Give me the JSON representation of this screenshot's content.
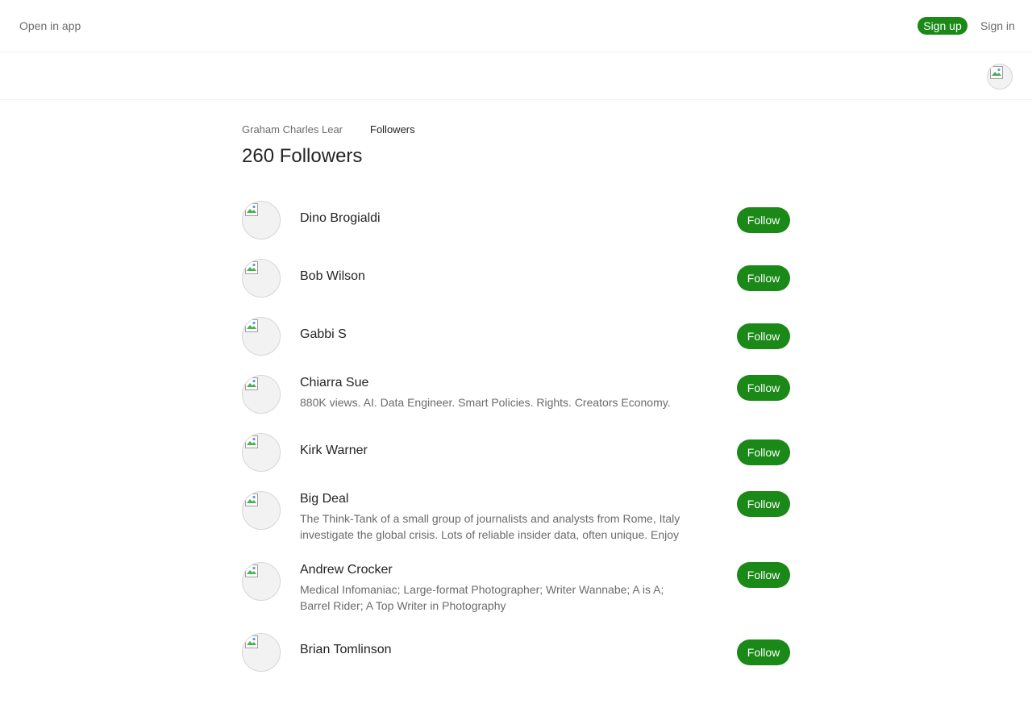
{
  "header": {
    "open_in_app": "Open in app",
    "sign_up": "Sign up",
    "sign_in": "Sign in"
  },
  "breadcrumb": {
    "author": "Graham Charles Lear",
    "current": "Followers"
  },
  "page_title": "260 Followers",
  "followers": [
    {
      "name": "Dino Brogialdi",
      "bio": "",
      "button": "Follow"
    },
    {
      "name": "Bob Wilson",
      "bio": "",
      "button": "Follow"
    },
    {
      "name": "Gabbi S",
      "bio": "",
      "button": "Follow"
    },
    {
      "name": "Chiarra Sue",
      "bio": "880K views. AI. Data Engineer. Smart Policies. Rights. Creators Economy.",
      "button": "Follow"
    },
    {
      "name": "Kirk Warner",
      "bio": "",
      "button": "Follow"
    },
    {
      "name": "Big Deal",
      "bio": "The Think-Tank of a small group of journalists and analysts from Rome, Italy investigate the global crisis. Lots of reliable insider data, often unique. Enjoy",
      "button": "Follow"
    },
    {
      "name": "Andrew Crocker",
      "bio": "Medical Infomaniac; Large-format Photographer; Writer Wannabe; A is A; Barrel Rider; A Top Writer in Photography",
      "button": "Follow"
    },
    {
      "name": "Brian Tomlinson",
      "bio": "",
      "button": "Follow"
    }
  ],
  "colors": {
    "accent": "#1a8917",
    "text_primary": "#242424",
    "text_secondary": "#6b6b6b"
  }
}
